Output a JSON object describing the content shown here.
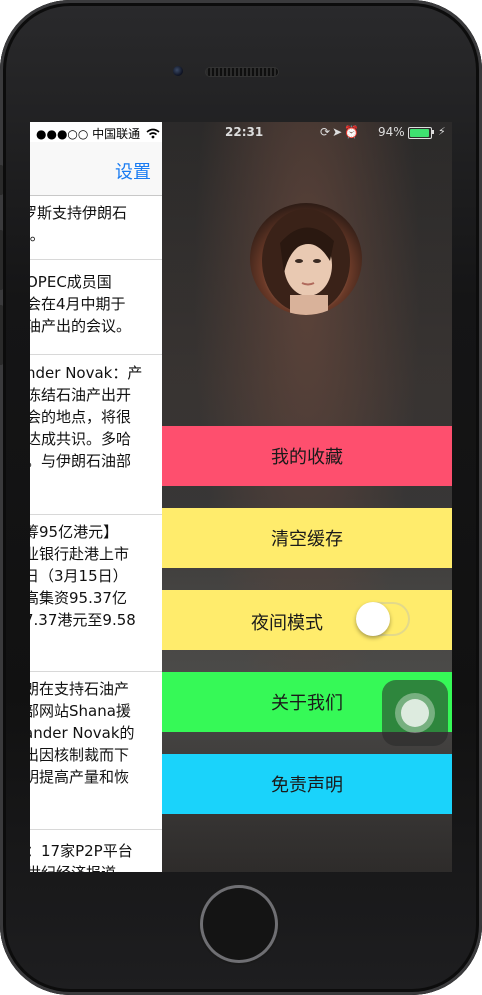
{
  "status_bar": {
    "carrier": "●●●○○ 中国联通",
    "time": "22:31",
    "battery_percent": "94%",
    "battery_level": 0.94
  },
  "main": {
    "nav_settings_label": "设置",
    "articles": [
      "罗斯支持伊朗石\n”。",
      "OPEC成员国\n会在4月中期于\n油产出的会议。",
      "nder Novak：产\n冻结石油产出开\n会的地点，将很\n达成共识。多哈\n。与伊朗石油部",
      "筹95亿港元】\n业银行赴港上市\n日（3月15日）\n高集资95.37亿\n7.37港元至9.58",
      "朗在支持石油产\n部网站Shana援\nander Novak的\n出因核制裁而下\n明提高产量和恢",
      "：17家P2P平台\n世纪经济报道"
    ]
  },
  "menu": {
    "items": [
      {
        "label": "我的收藏",
        "color": "#fe4f6e"
      },
      {
        "label": "清空缓存",
        "color": "#ffec6c"
      },
      {
        "label": "夜间模式",
        "color": "#ffec6c",
        "toggle_on": false
      },
      {
        "label": "关于我们",
        "color": "#36f957"
      },
      {
        "label": "免责声明",
        "color": "#1ad3fb"
      }
    ]
  },
  "colors": {
    "accent": "#1a7cf2",
    "battery": "#3ee070"
  },
  "icons": [
    "wifi-icon",
    "lock-rotation-icon",
    "location-icon",
    "alarm-icon",
    "battery-icon",
    "charging-icon",
    "assistive-touch-icon"
  ]
}
